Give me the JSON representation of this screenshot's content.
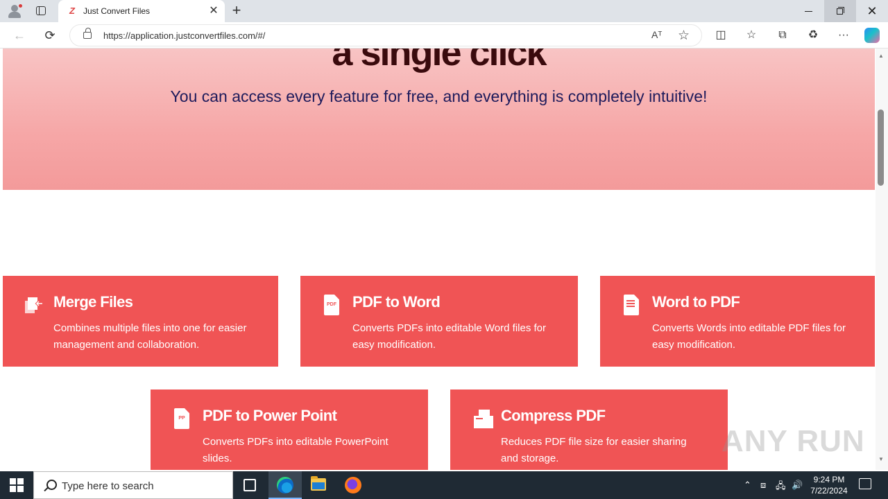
{
  "browser": {
    "tab_title": "Just Convert Files",
    "tab_favicon": "Z",
    "tab_close": "✕",
    "new_tab": "+",
    "url": "https://application.justconvertfiles.com/#/",
    "read_aloud": "Aᵀ",
    "favorite_star": "☆",
    "split_screen": "◫",
    "favorites": "☆",
    "collections": "⧉",
    "extensions": "♻",
    "more": "···",
    "back": "←",
    "reload": "⟳",
    "window_close": "✕"
  },
  "hero": {
    "title_fragment": "a single click",
    "subtitle": "You can access every feature for free, and everything is completely intuitive!"
  },
  "features": [
    {
      "title": "Merge Files",
      "description": "Combines multiple files into one for easier management and collaboration.",
      "icon": "merge-files-icon"
    },
    {
      "title": "PDF to Word",
      "description": "Converts PDFs into editable Word files for easy modification.",
      "icon": "pdf-icon",
      "icon_label": "PDF"
    },
    {
      "title": "Word to PDF",
      "description": "Converts Words into editable PDF files for easy modification.",
      "icon": "word-doc-icon"
    },
    {
      "title": "PDF to Power Point",
      "description": "Converts PDFs into editable PowerPoint slides.",
      "icon": "powerpoint-icon",
      "icon_label": "PP"
    },
    {
      "title": "Compress PDF",
      "description": "Reduces PDF file size for easier sharing and storage.",
      "icon": "compress-icon"
    }
  ],
  "watermark": "ANY RUN",
  "colors": {
    "card": "#f05455",
    "hero_top": "#f8c4c4",
    "hero_bottom": "#f39a9a",
    "hero_title": "#3a0a0d",
    "hero_subtitle": "#1d1a5b"
  },
  "taskbar": {
    "search_placeholder": "Type here to search",
    "time": "9:24 PM",
    "date": "7/22/2024",
    "tray_up": "⌃",
    "tray_network": "🖧",
    "tray_volume": "🔊"
  }
}
